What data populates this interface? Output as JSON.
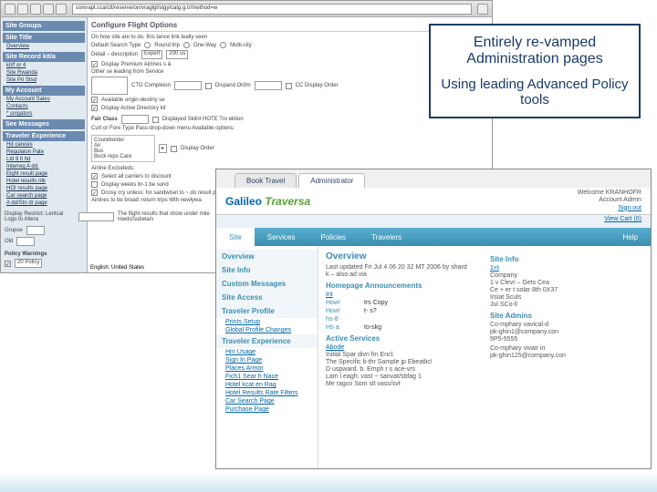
{
  "callout": {
    "line1": "Entirely re-vamped Administration pages",
    "line2": "Using leading Advanced Policy tools"
  },
  "back": {
    "url": "comrapt.cca/clt/reserve/on/vraglgl/stgy/catg.g.tr/method=w",
    "sidebar": {
      "groups": [
        {
          "hdr": "Site Groups",
          "items": []
        },
        {
          "hdr": "Site Title",
          "items": [
            "Overview"
          ]
        },
        {
          "hdr": "Site Record kit/a",
          "items": [
            "kit/f or 4",
            "Site Rwanda",
            "Site Pri Stsd"
          ]
        },
        {
          "hdr": "My Account",
          "items": [
            "My Account Sales",
            "Contacts",
            "* snigators"
          ]
        },
        {
          "hdr": "See Messages",
          "items": []
        },
        {
          "hdr": "Traveler Experience",
          "items": [
            "Hd canoes",
            "Regulaion Pate",
            "Ltd 8 lt hd",
            "Interreg A dd.",
            "Eight result page",
            "Hotel results ntk",
            "HOI results page",
            "Car search page",
            "A dd/Stn dr page"
          ]
        }
      ]
    },
    "main": {
      "title": "Configure Flight Options",
      "subtitle": "On how site are to do. this tance link teally seen",
      "searchType": "Default Search Type",
      "radios": [
        "Round trip",
        "One-Way",
        "Multi-city"
      ],
      "expertLabel": "Detail – description",
      "expertSel": "Expert",
      "expertNum": "200 us",
      "check1": "Display Premium Airlines s &",
      "availChk": "Available origin-destiny se",
      "dispChk": "Display Active Directory kit",
      "subhdr1": "Other se leading from Service",
      "opts": [
        "CTO Compleion",
        "Dispand Ordm",
        "CC Display Order"
      ],
      "fairClass": "Fair Class",
      "fairOpt": "Displayed Skilnt HOTE Tro ektion",
      "carrierHdr": "Curt or Fore Type Pass-drop-down menu Available options:",
      "carrierItems": [
        "Courebooter",
        "Air",
        "Bus",
        "Buck reps Care"
      ],
      "dispOrder": "Display Order",
      "airlineHdr": "Airline Excludeds:",
      "airlineChks": [
        "Select all carriers to discount",
        "Display weeks br-1 be sund",
        "Dcosy cry unless: for sandwiset to ~ do result page"
      ],
      "airlinesList": "Airlines to be broad: return trips Wth newlywa",
      "footer": {
        "lang": "English: United States",
        "restrict": "Display Restrict: Lentcal Logo to Altera",
        "groups": "Grupse",
        "note": "The flight results that show under mile mwds/subela/s",
        "old": "Old",
        "policyHdr": "Policy Warnings",
        "policySel": "20 Policy"
      }
    }
  },
  "front": {
    "tabs": [
      "Book Travel",
      "Administrator"
    ],
    "logo1": "Galileo",
    "logo2": "Traversa",
    "welcome": "Welcome KRANHOFR",
    "acct": "Account Admin",
    "signout": "Sign out",
    "cart": "View Cart (0)",
    "nav": [
      "Site",
      "Services",
      "Policies",
      "Travelers"
    ],
    "help": "Help",
    "side_sections": [
      {
        "title": "Overview",
        "links": []
      },
      {
        "title": "Site Info",
        "links": []
      },
      {
        "title": "Custom Messages",
        "links": []
      },
      {
        "title": "Site Access",
        "links": []
      },
      {
        "title": "Traveler Profile",
        "links": [
          "Prints Setup",
          "Global Profile Changes"
        ]
      },
      {
        "title": "Traveler Experience",
        "links": [
          "Hm Usage",
          "Sign In Page",
          "Places Armor",
          "Fich1 Sear h Nace",
          "Hotel kcat en Rag",
          "Hotel Results Rate Filters",
          "Car Search Page",
          "Purchase Page"
        ]
      }
    ],
    "overview": {
      "title": "Overview",
      "updated": "Last updated Fri Jul 4 06 20 32 MT 2006 by shard",
      "updatedSub": "k – also ad via",
      "annHdr": "Homepage Announcements",
      "annVal": "Int",
      "rows": [
        {
          "k": "How!",
          "v": "trs Copy"
        },
        {
          "k": "How!",
          "v": "t- s?"
        },
        {
          "k": "hs-8",
          "v": ""
        },
        {
          "k": "Hs·a",
          "v": "to-skg"
        }
      ],
      "servicesHdr": "Active Services",
      "servicesLink": "Abode",
      "servicesList": [
        "Initial Spar divn fm Encl.",
        "The Specific b-thr Sample jp Ebeatlic!",
        "D uspward. b. Emph r s ace-vrs",
        "Lam l eagh: vast ~ sanvat/sbfag 1",
        "Me ragco Som slt vass/svt"
      ]
    },
    "siteinfo": {
      "title": "Site Info",
      "editLink": "1<t",
      "company": "Company",
      "addr1": "1 v Clevr – Gets Cea",
      "addr2": "Ce + er t solar 8th 0X37",
      "status": "Irsiat Sculs",
      "date": "Jul SCo-ll",
      "adminsHdr": "Site Admins",
      "admin1": [
        "Co-mphary vavical-d",
        "pk-ghin1@company.con",
        "5P5-5555"
      ],
      "admin2": [
        "Co-mphary vivair in",
        "pk-ghin125@company.con"
      ]
    }
  }
}
